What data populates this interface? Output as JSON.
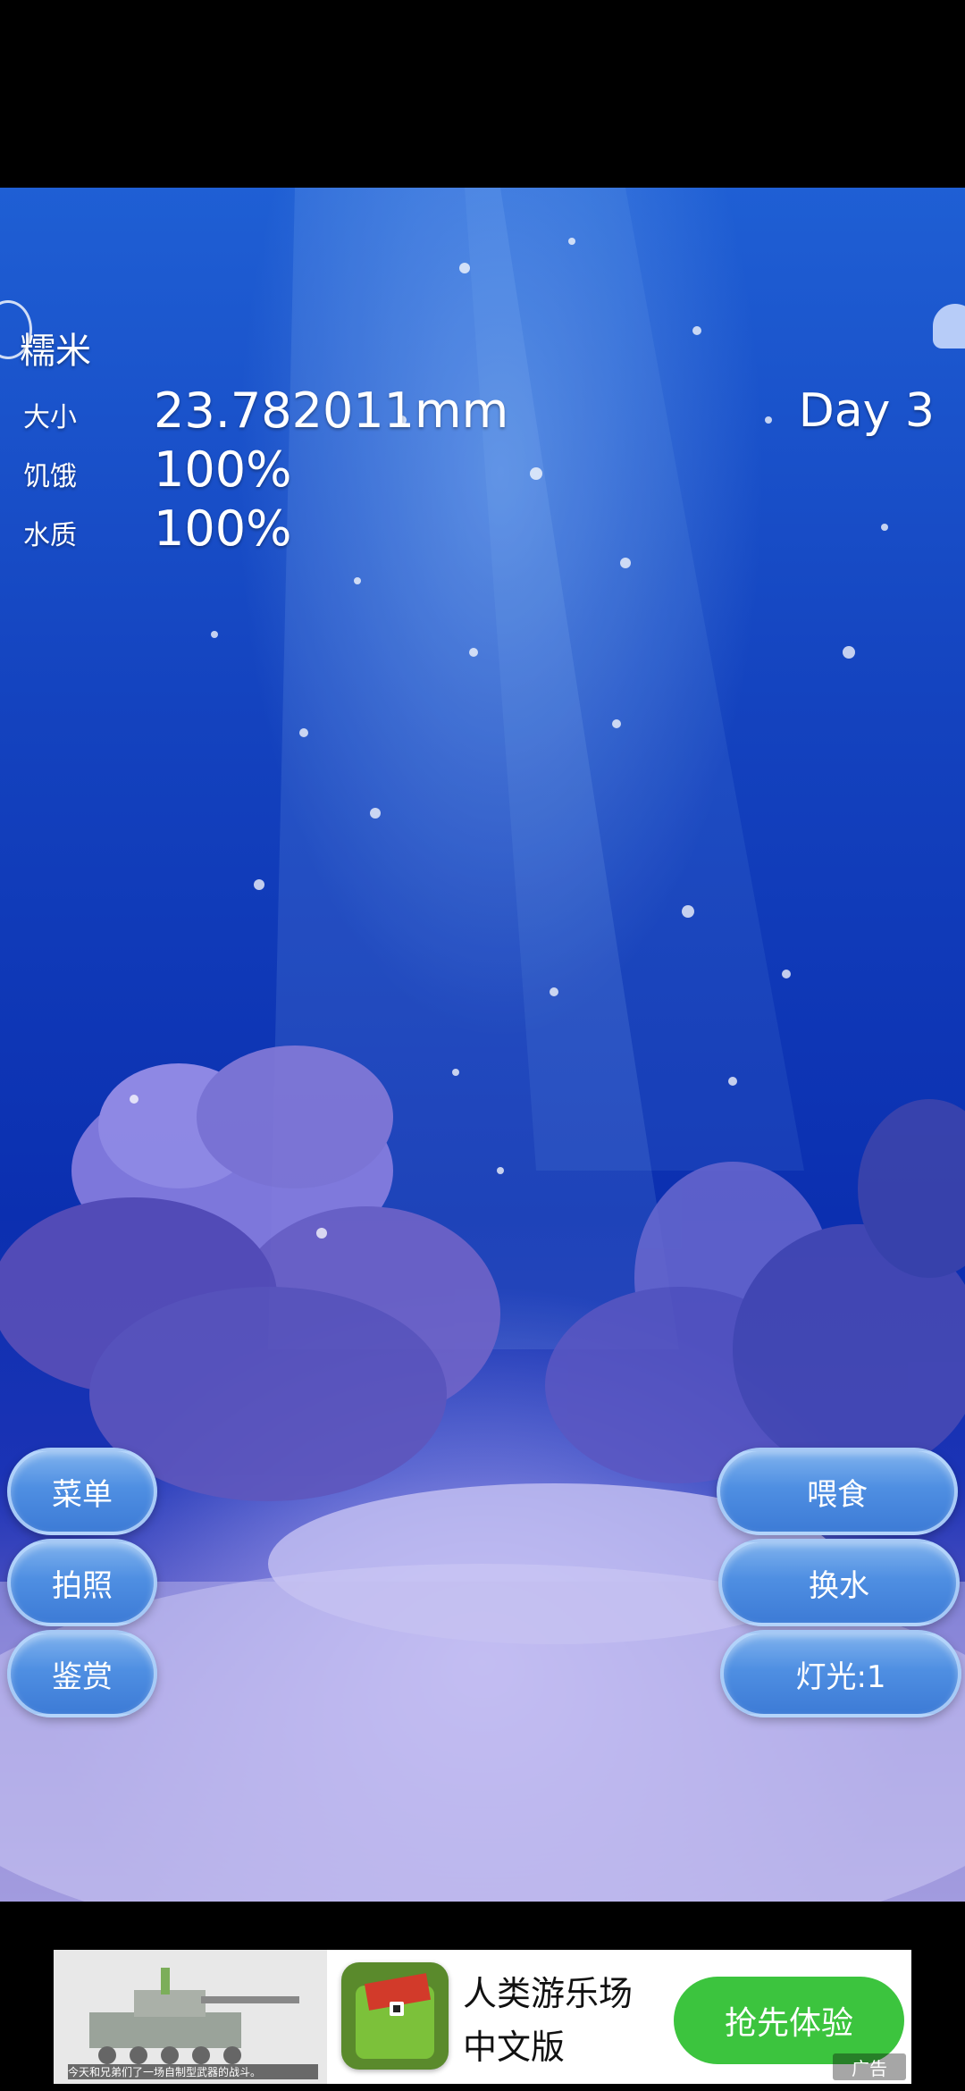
{
  "fish": {
    "name": "糯米",
    "stats": [
      {
        "label": "大小",
        "value": "23.782011mm"
      },
      {
        "label": "饥饿",
        "value": "100%"
      },
      {
        "label": "水质",
        "value": "100%"
      }
    ],
    "day": "Day 3"
  },
  "left_buttons": [
    "菜单",
    "拍照",
    "鉴赏"
  ],
  "right_buttons": [
    "喂食",
    "换水",
    "灯光:1"
  ],
  "ad": {
    "title_line1": "人类游乐场",
    "title_line2": "中文版",
    "cta": "抢先体验",
    "caption": "今天和兄弟们了一场自制型武器的战斗。",
    "badge": "广告",
    "cta_color": "#3cc43e"
  }
}
